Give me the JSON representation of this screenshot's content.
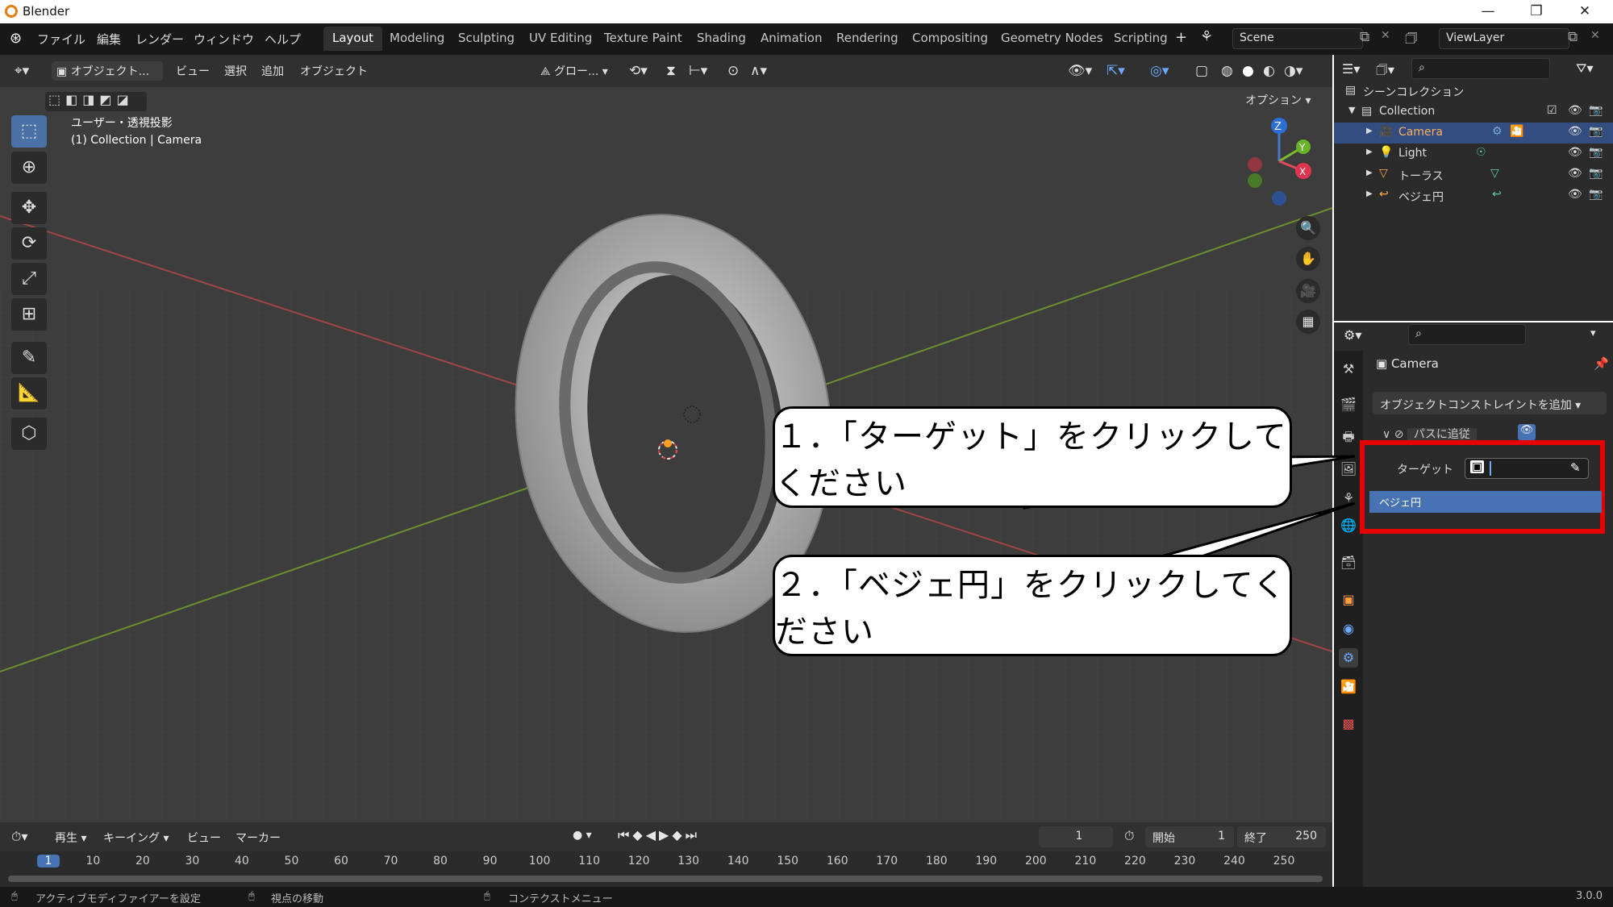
{
  "window": {
    "title": "Blender",
    "minimize": "—",
    "maximize": "❐",
    "close": "✕"
  },
  "menu": [
    "ファイル",
    "編集",
    "レンダー",
    "ウィンドウ",
    "ヘルプ"
  ],
  "workspaces": [
    "Layout",
    "Modeling",
    "Sculpting",
    "UV Editing",
    "Texture Paint",
    "Shading",
    "Animation",
    "Rendering",
    "Compositing",
    "Geometry Nodes",
    "Scripting"
  ],
  "active_workspace": "Layout",
  "add_workspace": "+",
  "scene": {
    "label": "Scene",
    "viewlayer": "ViewLayer"
  },
  "viewport_header": {
    "mode": "オブジェクト...",
    "view": "ビュー",
    "select": "選択",
    "add": "追加",
    "object": "オブジェクト",
    "transform_orientation": "グロー...",
    "options": "オプション"
  },
  "viewport_overlay": {
    "line1": "ユーザー・透視投影",
    "line2": "(1) Collection | Camera"
  },
  "gizmo": {
    "z": "Z",
    "y": "Y",
    "x": "X"
  },
  "outliner": {
    "root": "シーンコレクション",
    "collection": "Collection",
    "items": [
      {
        "name": "Camera",
        "icon": "camera-icon",
        "selected": true
      },
      {
        "name": "Light",
        "icon": "light-icon",
        "selected": false
      },
      {
        "name": "トーラス",
        "icon": "mesh-icon",
        "selected": false
      },
      {
        "name": "ベジェ円",
        "icon": "curve-icon",
        "selected": false
      }
    ]
  },
  "properties": {
    "object_name": "Camera",
    "add_constraint": "オブジェクトコンストレイントを追加",
    "constraint_name": "パスに追従",
    "target_label": "ターゲット",
    "dropdown_option": "ベジェ円"
  },
  "callouts": {
    "step1": "１．「ターゲット」をクリックしてください",
    "step2": "２．「ベジェ円」をクリックしてください"
  },
  "timeline": {
    "playback": "再生",
    "keying": "キーイング",
    "view": "ビュー",
    "marker": "マーカー",
    "current_frame": "1",
    "start_label": "開始",
    "start": "1",
    "end_label": "終了",
    "end": "250",
    "ticks": [
      "1",
      "10",
      "20",
      "30",
      "40",
      "50",
      "60",
      "70",
      "80",
      "90",
      "100",
      "110",
      "120",
      "130",
      "140",
      "150",
      "160",
      "170",
      "180",
      "190",
      "200",
      "210",
      "220",
      "230",
      "240",
      "250"
    ]
  },
  "statusbar": {
    "left": "アクティブモディファイアーを設定",
    "middle": "視点の移動",
    "right": "コンテクストメニュー",
    "version": "3.0.0"
  },
  "colors": {
    "accent": "#4a70a8",
    "selected_row": "#334d80",
    "highlight": "#e60000",
    "dropdown_sel": "#4772b3"
  }
}
